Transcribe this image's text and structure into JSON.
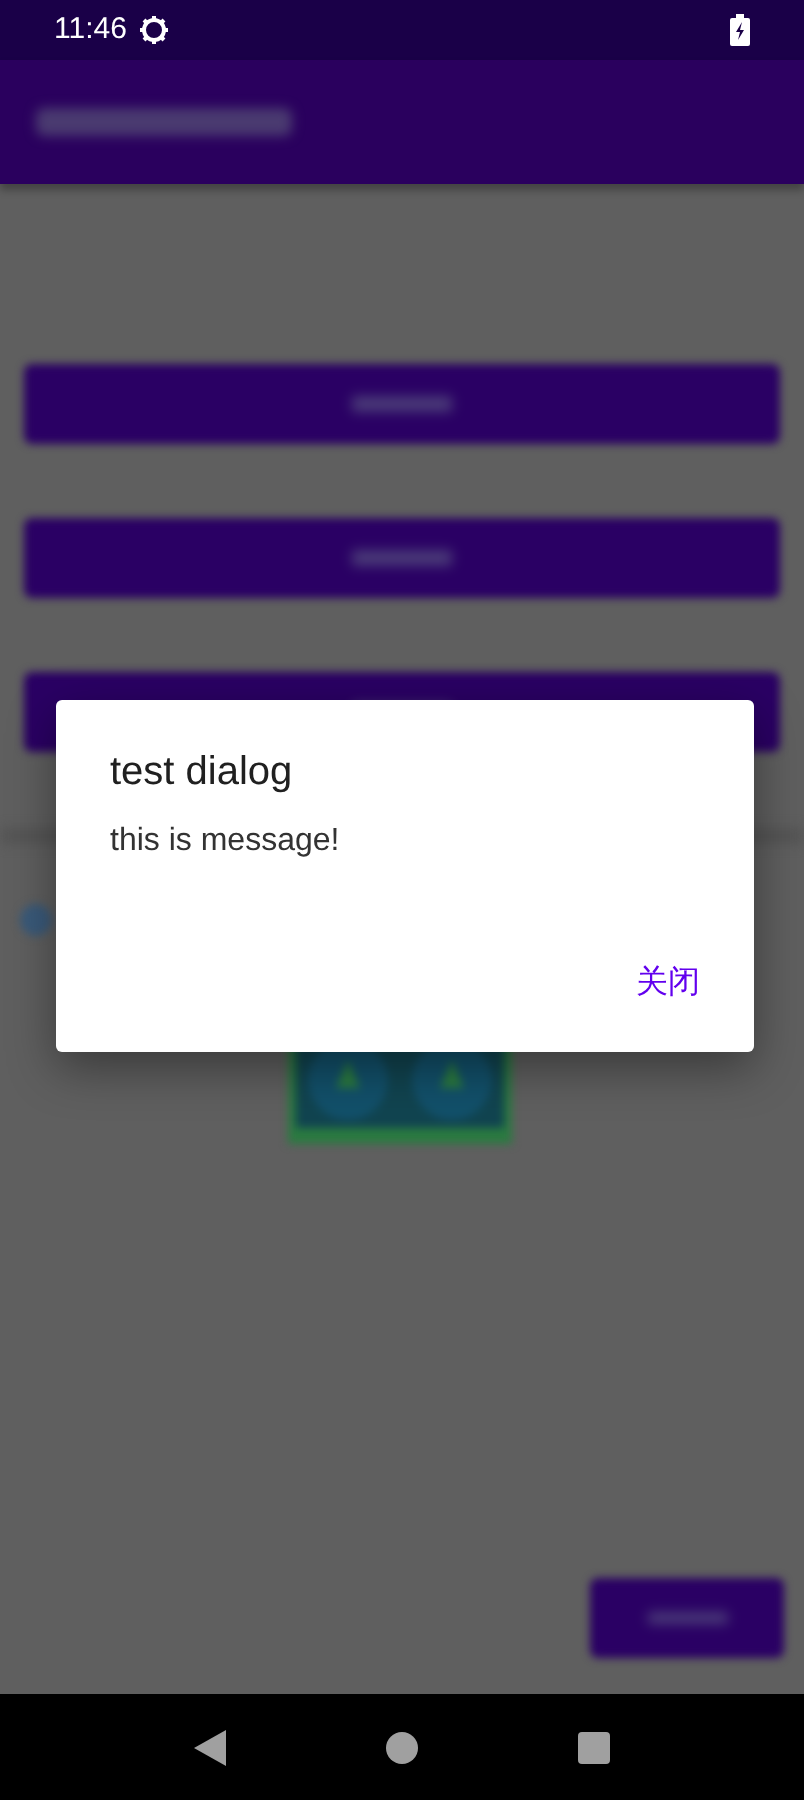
{
  "status_bar": {
    "time": "11:46"
  },
  "dialog": {
    "title": "test dialog",
    "message": "this is message!",
    "button": "关闭"
  }
}
